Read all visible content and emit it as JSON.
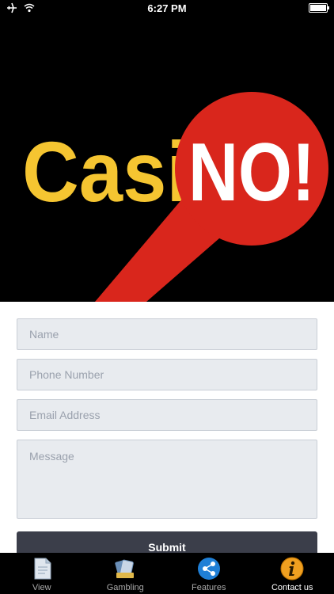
{
  "status_bar": {
    "time": "6:27 PM"
  },
  "banner": {
    "logo_text_left": "Casi",
    "logo_text_right": "NO!"
  },
  "form": {
    "name_placeholder": "Name",
    "phone_placeholder": "Phone Number",
    "email_placeholder": "Email Address",
    "message_placeholder": "Message",
    "submit_label": "Submit"
  },
  "tabs": [
    {
      "label": "View",
      "icon": "document-icon"
    },
    {
      "label": "Gambling",
      "icon": "cards-icon"
    },
    {
      "label": "Features",
      "icon": "share-icon"
    },
    {
      "label": "Contact us",
      "icon": "info-icon"
    }
  ],
  "colors": {
    "logo_yellow": "#f5c531",
    "logo_red": "#d9261c",
    "submit_bg": "#3b3e4a",
    "field_bg": "#e8ebef"
  }
}
